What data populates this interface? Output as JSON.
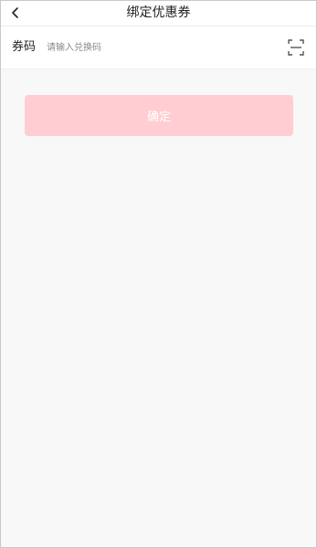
{
  "header": {
    "title": "绑定优惠券",
    "back_icon": "chevron-left-icon"
  },
  "coupon_form": {
    "label": "券码",
    "input_placeholder": "请输入兑换码",
    "input_value": "",
    "scan_icon": "scan-icon"
  },
  "actions": {
    "confirm_label": "确定"
  },
  "colors": {
    "page_background": "#f8f8f8",
    "confirm_button": "#ffcdd2",
    "confirm_text": "#ffffff"
  }
}
